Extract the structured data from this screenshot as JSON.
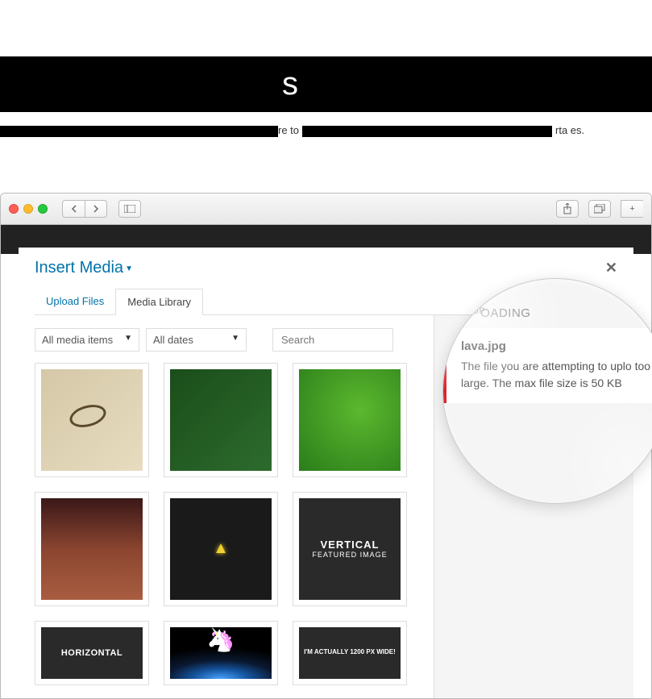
{
  "header": {
    "partial_suffix": "s",
    "description_mid": "re to",
    "description_end": "rta     es."
  },
  "modal": {
    "title": "Insert Media",
    "tabs": [
      {
        "label": "Upload Files",
        "active": false
      },
      {
        "label": "Media Library",
        "active": true
      }
    ],
    "filters": {
      "media_type": "All media items",
      "date": "All dates"
    },
    "search_placeholder": "Search",
    "thumbnails": [
      {
        "name": "glasses",
        "label": ""
      },
      {
        "name": "fern",
        "label": ""
      },
      {
        "name": "leaf",
        "label": ""
      },
      {
        "name": "sausages",
        "label": ""
      },
      {
        "name": "triforce",
        "label": ""
      },
      {
        "name": "vertical",
        "label_1": "VERTICAL",
        "label_2": "FEATURED IMAGE"
      },
      {
        "name": "horizontal",
        "label": "HORIZONTAL"
      },
      {
        "name": "unicorn",
        "label": ""
      },
      {
        "name": "wide",
        "label": "I'M ACTUALLY 1200 PX WIDE!"
      }
    ],
    "upload": {
      "heading": "OADING",
      "sub": "UP",
      "filename": "lava.jpg",
      "error": "The file you are attempting to uplo    too large. The max file size is 50 KB"
    }
  }
}
